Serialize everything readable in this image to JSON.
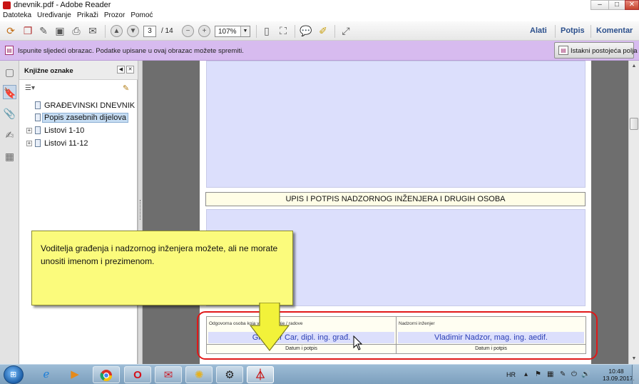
{
  "window": {
    "title": "dnevnik.pdf - Adobe Reader",
    "controls": {
      "minimize": "–",
      "maximize": "□",
      "close": "✕"
    }
  },
  "menu": [
    "Datoteka",
    "Uređivanje",
    "Prikaži",
    "Prozor",
    "Pomoć"
  ],
  "toolbar": {
    "current_page": "3",
    "total_pages": "/ 14",
    "zoom": "107%",
    "right_tabs": [
      "Alati",
      "Potpis",
      "Komentar"
    ]
  },
  "notice": {
    "text": "Ispunite sljedeći obrazac. Podatke upisane u ovaj obrazac možete spremiti.",
    "highlight_button": "Istakni postojeća polja"
  },
  "bookmarks": {
    "header": "Knjižne oznake",
    "items": [
      {
        "label": "GRAĐEVINSKI DNEVNIK",
        "expandable": false,
        "selected": false
      },
      {
        "label": "Popis zasebnih dijelova",
        "expandable": false,
        "selected": true
      },
      {
        "label": "Listovi 1-10",
        "expandable": true,
        "selected": false
      },
      {
        "label": "Listovi 11-12",
        "expandable": true,
        "selected": false
      }
    ]
  },
  "document": {
    "section_title": "UPIS I POTPIS NADZORNOG INŽENJERA I DRUGIH OSOBA",
    "signatures": [
      {
        "caption": "Odgovorna osoba koja vodi građenje / radove",
        "name": "Gradimir Car, dipl. ing. građ.",
        "date_label": "Datum i potpis"
      },
      {
        "caption": "Nadzorni inženjer",
        "name": "Vladimir Nadzor, mag. ing. aedif.",
        "date_label": "Datum i potpis"
      }
    ]
  },
  "callout": {
    "text": "Voditelja građenja i nadzornog inženjera možete, ali ne morate unositi imenom i prezimenom."
  },
  "taskbar": {
    "apps": [
      "internet-explorer",
      "media-player",
      "chrome",
      "opera",
      "mail",
      "solitaire-app",
      "network-app",
      "adobe-reader"
    ],
    "tray": {
      "lang": "HR",
      "time": "10:48",
      "date": "13.09.2017."
    }
  },
  "colors": {
    "notice_bg": "#d7bbef",
    "form_field": "#dcdffc",
    "highlight_ring": "#e01818",
    "callout_bg": "#fbfb7c"
  }
}
